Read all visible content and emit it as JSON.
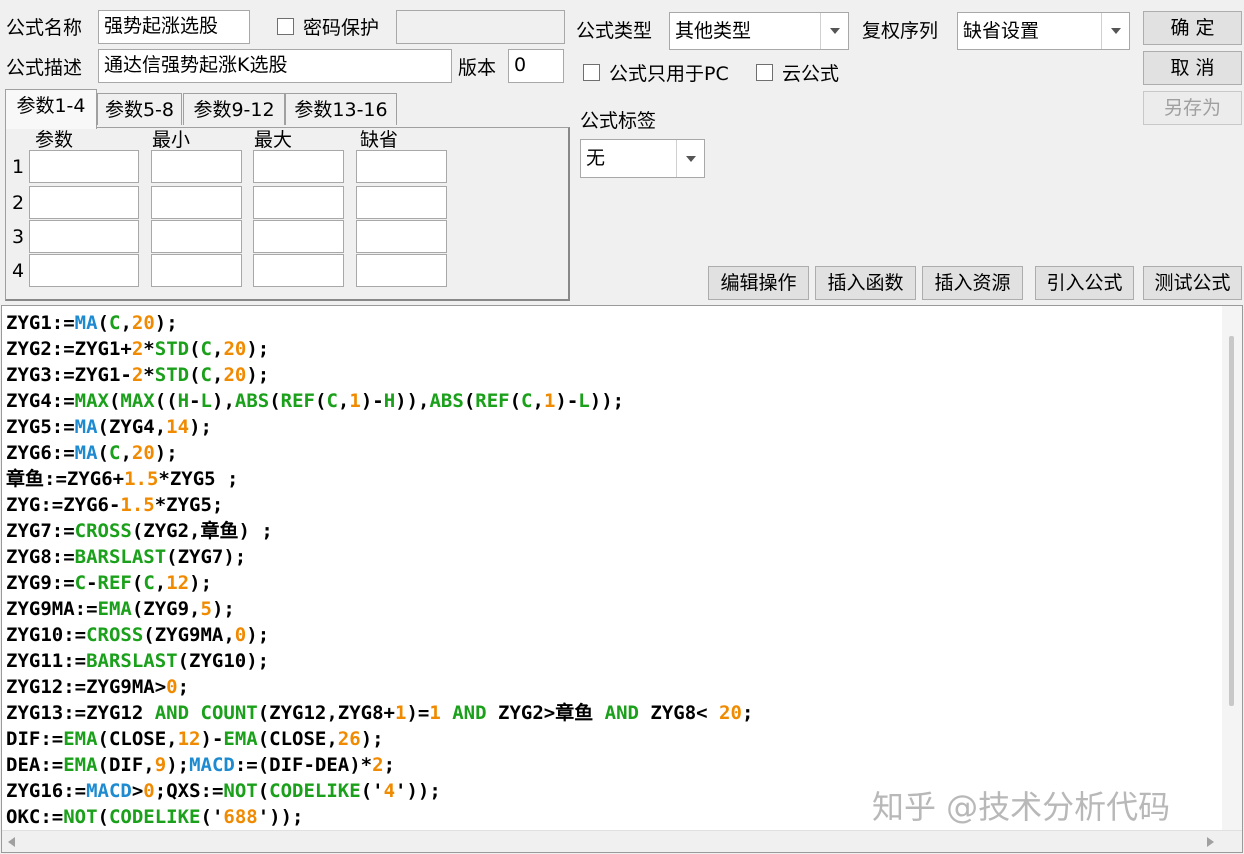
{
  "formula": {
    "name_label": "公式名称",
    "name_value": "强势起涨选股",
    "password_label": "密码保护",
    "desc_label": "公式描述",
    "desc_value": "通达信强势起涨K选股",
    "version_label": "版本",
    "version_value": "0",
    "type_label": "公式类型",
    "type_value": "其他类型",
    "restore_label": "复权序列",
    "restore_value": "缺省设置",
    "pc_only_label": "公式只用于PC",
    "cloud_label": "云公式",
    "tag_label": "公式标签",
    "tag_value": "无"
  },
  "buttons": {
    "ok": "确  定",
    "cancel": "取  消",
    "save_as": "另存为",
    "edit": "编辑操作",
    "insert_func": "插入函数",
    "insert_res": "插入资源",
    "import": "引入公式",
    "test": "测试公式"
  },
  "tabs": [
    "参数1-4",
    "参数5-8",
    "参数9-12",
    "参数13-16"
  ],
  "params": {
    "headers": [
      "参数",
      "最小",
      "最大",
      "缺省"
    ],
    "rows": [
      "1",
      "2",
      "3",
      "4"
    ]
  },
  "code_lines": [
    "ZYG1:=MA(C,20);",
    "ZYG2:=ZYG1+2*STD(C,20);",
    "ZYG3:=ZYG1-2*STD(C,20);",
    "ZYG4:=MAX(MAX((H-L),ABS(REF(C,1)-H)),ABS(REF(C,1)-L));",
    "ZYG5:=MA(ZYG4,14);",
    "ZYG6:=MA(C,20);",
    "章鱼:=ZYG6+1.5*ZYG5 ;",
    "ZYG:=ZYG6-1.5*ZYG5;",
    "ZYG7:=CROSS(ZYG2,章鱼) ;",
    "ZYG8:=BARSLAST(ZYG7);",
    "ZYG9:=C-REF(C,12);",
    "ZYG9MA:=EMA(ZYG9,5);",
    "ZYG10:=CROSS(ZYG9MA,0);",
    "ZYG11:=BARSLAST(ZYG10);",
    "ZYG12:=ZYG9MA>0;",
    "ZYG13:=ZYG12 AND COUNT(ZYG12,ZYG8+1)=1 AND ZYG2>章鱼 AND ZYG8< 20;",
    "DIF:=EMA(CLOSE,12)-EMA(CLOSE,26);",
    "DEA:=EMA(DIF,9);MACD:=(DIF-DEA)*2;",
    "ZYG16:=MACD>0;QXS:=NOT(CODELIKE('4'));",
    "OKC:=NOT(CODELIKE('688'));"
  ],
  "colors": {
    "function": "#1aa01a",
    "builtin": "#1e8bd0",
    "number": "#f08a00"
  },
  "watermark": "知乎 @技术分析代码"
}
